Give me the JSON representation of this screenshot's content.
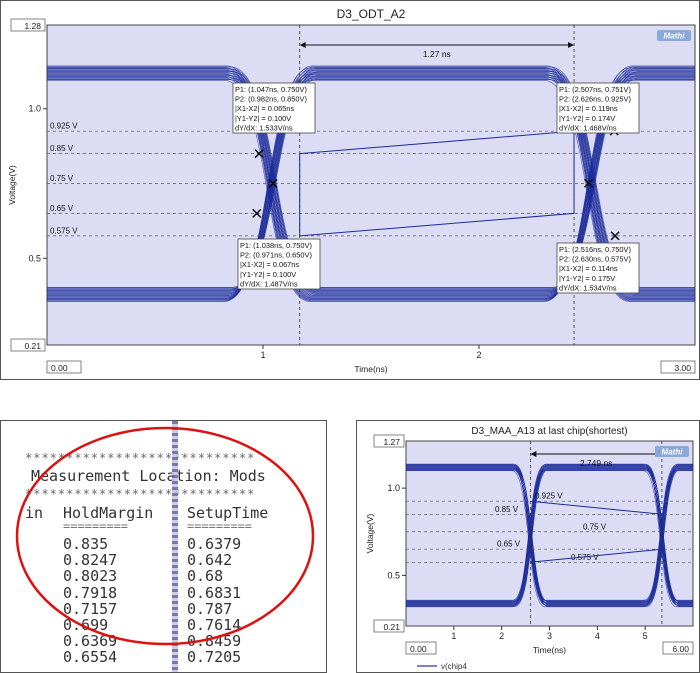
{
  "chart_data": [
    {
      "type": "line",
      "title": "D3_ODT_A2",
      "xlabel": "Time(ns)",
      "ylabel": "Voltage(V)",
      "xlim": [
        0.0,
        3.0
      ],
      "ylim": [
        0.21,
        1.28
      ],
      "x_range_labels": [
        "0.00",
        "3.00"
      ],
      "y_range_labels": [
        "1.28",
        "0.21"
      ],
      "x_ticks": [
        "1",
        "2"
      ],
      "y_ticks": [
        "1.0",
        "0.5"
      ],
      "level_labels": [
        "0.925 V",
        "0.85 V",
        "0.75 V",
        "0.65 V",
        "0.575 V"
      ],
      "levels": [
        0.925,
        0.85,
        0.75,
        0.65,
        0.575
      ],
      "high_level": 1.12,
      "low_level": 0.38,
      "crossings": [
        1.04,
        2.52
      ],
      "markers_x": [
        1.17,
        2.44
      ],
      "span_label": "1.27 ns",
      "logo": "Mathi",
      "annotations": [
        {
          "lines": [
            "P1: (1.047ns, 0.750V)",
            "P2: (0.982ns, 0.850V)",
            "|X1-X2| = 0.065ns",
            "|Y1-Y2| = 0.100V",
            "dY/dX: 1.533V/ns"
          ]
        },
        {
          "lines": [
            "P1: (2.507ns, 0.751V)",
            "P2: (2.626ns, 0.925V)",
            "|X1-X2| = 0.119ns",
            "|Y1-Y2| = 0.174V",
            "dY/dX: 1.468V/ns"
          ]
        },
        {
          "lines": [
            "P1: (1.038ns, 0.750V)",
            "P2: (0.971ns, 0.650V)",
            "|X1-X2| = 0.067ns",
            "|Y1-Y2| = 0.100V",
            "dY/dX: 1.487V/ns"
          ]
        },
        {
          "lines": [
            "P1: (2.516ns, 0.750V)",
            "P2: (2.630ns, 0.575V)",
            "|X1-X2| = 0.114ns",
            "|Y1-Y2| = 0.175V",
            "dY/dX: 1.534V/ns"
          ]
        }
      ]
    },
    {
      "type": "line",
      "title": "D3_MAA_A13 at last chip(shortest)",
      "xlabel": "Time(ns)",
      "ylabel": "Voltage(V)",
      "xlim": [
        0.0,
        6.0
      ],
      "ylim": [
        0.21,
        1.27
      ],
      "x_range_labels": [
        "0.00",
        "6.00"
      ],
      "y_range_labels": [
        "1.27",
        "0.21"
      ],
      "x_ticks": [
        "1",
        "2",
        "3",
        "4",
        "5"
      ],
      "y_ticks": [
        "1.0",
        "0.5"
      ],
      "level_labels": [
        "0.925 V",
        "0.85 V",
        "0.75 V",
        "0.65 V",
        "0.575 V"
      ],
      "levels": [
        0.925,
        0.85,
        0.75,
        0.65,
        0.575
      ],
      "high_level": 1.12,
      "low_level": 0.34,
      "crossings": [
        2.6,
        5.35
      ],
      "markers_x": [
        2.6,
        5.35
      ],
      "span_label": "2.749 ns",
      "logo": "Mathi",
      "legend": "v(chip4",
      "legend_color": "#3333aa"
    }
  ],
  "table": {
    "separator": "****************************",
    "header_line": "Measurement Location: Mods",
    "col_partial": "in",
    "col_hold": "HoldMargin",
    "col_setup": "SetupTime",
    "underline": "=========",
    "rows": [
      {
        "hold": "0.835",
        "setup": "0.6379"
      },
      {
        "hold": "0.8247",
        "setup": "0.642"
      },
      {
        "hold": "0.8023",
        "setup": "0.68"
      },
      {
        "hold": "0.7918",
        "setup": "0.6831"
      },
      {
        "hold": "0.7157",
        "setup": "0.787"
      },
      {
        "hold": "0.699",
        "setup": "0.7614"
      },
      {
        "hold": "0.6369",
        "setup": "0.8459"
      },
      {
        "hold": "0.6554",
        "setup": "0.7205"
      }
    ],
    "ellipse_color": "#dd1111"
  },
  "colors": {
    "plot_bg": "#dcdcf4",
    "wave": "#1a2a9a",
    "grid": "#555555"
  }
}
